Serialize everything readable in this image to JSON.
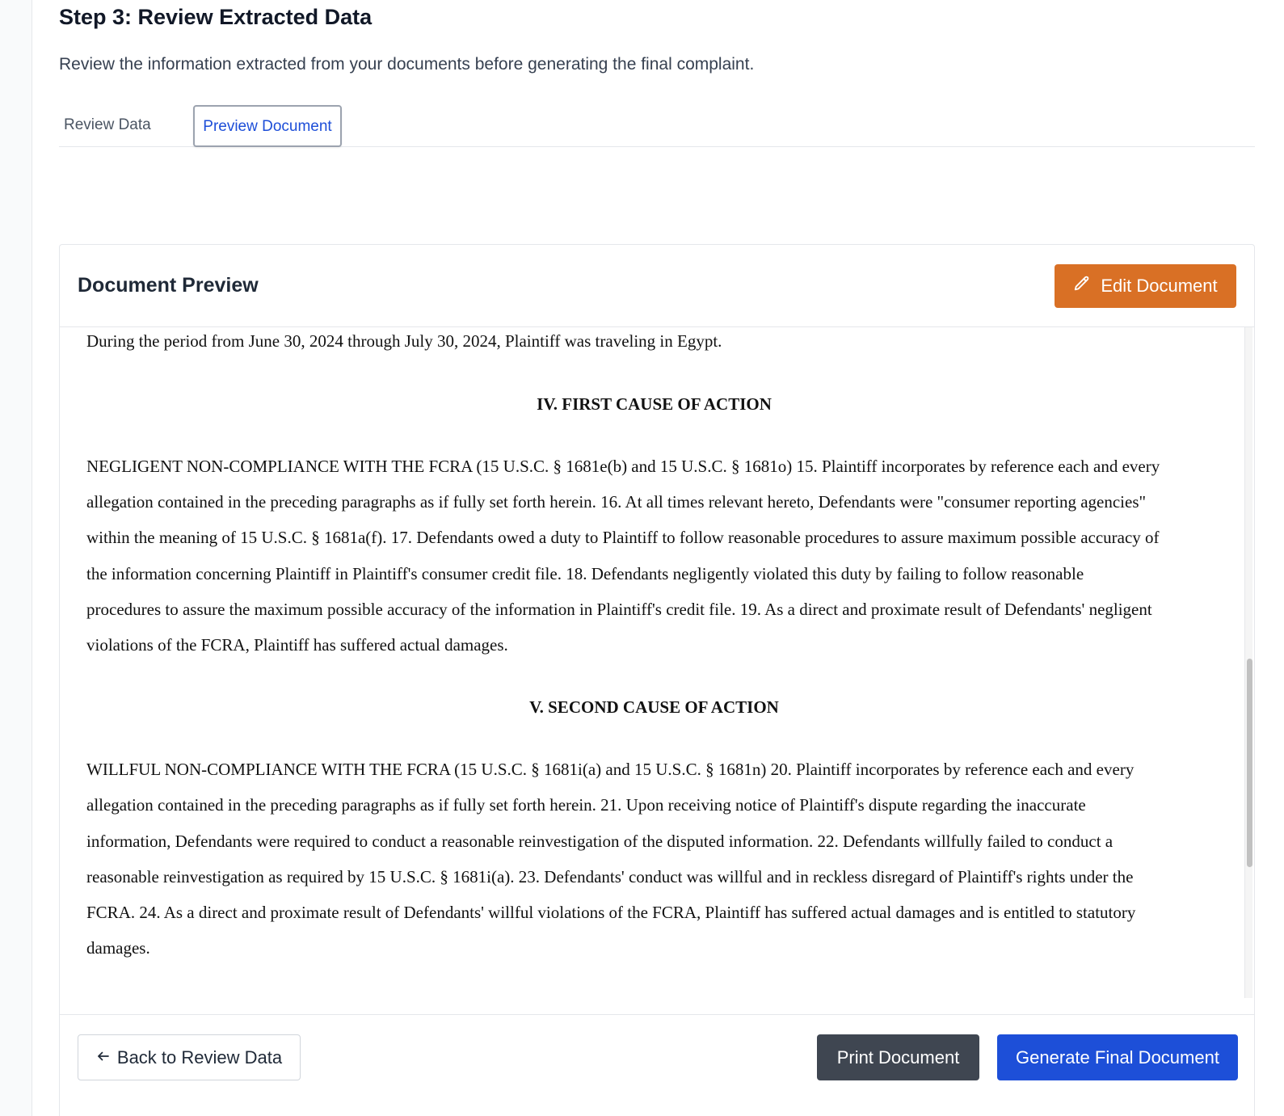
{
  "step": {
    "title": "Step 3: Review Extracted Data",
    "description": "Review the information extracted from your documents before generating the final complaint."
  },
  "tabs": [
    {
      "label": "Review Data",
      "active": false
    },
    {
      "label": "Preview Document",
      "active": true
    }
  ],
  "preview": {
    "title": "Document Preview",
    "edit_label": "Edit Document",
    "edit_icon": "pencil-icon",
    "edit_color": "#d97025"
  },
  "document": {
    "intro": "During the period from June 30, 2024 through July 30, 2024, Plaintiff was traveling in Egypt.",
    "heading1": "IV. FIRST CAUSE OF ACTION",
    "para1_lines": [
      "NEGLIGENT NON-COMPLIANCE WITH THE FCRA (15 U.S.C. § 1681e(b) and 15 U.S.C. § 1681o) 15. Plaintiff incorporates by reference each and every",
      "allegation contained in the preceding paragraphs as if fully set forth herein. 16. At all times relevant hereto, Defendants were \"consumer reporting agencies\"",
      "within the meaning of 15 U.S.C. § 1681a(f). 17. Defendants owed a duty to Plaintiff to follow reasonable procedures to assure maximum possible accuracy of",
      "the information concerning Plaintiff in Plaintiff's consumer credit file. 18. Defendants negligently violated this duty by failing to follow reasonable",
      "procedures to assure the maximum possible accuracy of the information in Plaintiff's credit file. 19. As a direct and proximate result of Defendants' negligent",
      "violations of the FCRA, Plaintiff has suffered actual damages."
    ],
    "heading2": "V. SECOND CAUSE OF ACTION",
    "para2_lines": [
      "WILLFUL NON-COMPLIANCE WITH THE FCRA (15 U.S.C. § 1681i(a) and 15 U.S.C. § 1681n) 20. Plaintiff incorporates by reference each and every",
      "allegation contained in the preceding paragraphs as if fully set forth herein. 21. Upon receiving notice of Plaintiff's dispute regarding the inaccurate",
      "information, Defendants were required to conduct a reasonable reinvestigation of the disputed information. 22. Defendants willfully failed to conduct a",
      "reasonable reinvestigation as required by 15 U.S.C. § 1681i(a). 23. Defendants' conduct was willful and in reckless disregard of Plaintiff's rights under the",
      "FCRA. 24. As a direct and proximate result of Defendants' willful violations of the FCRA, Plaintiff has suffered actual damages and is entitled to statutory",
      "damages."
    ]
  },
  "footer": {
    "back_label": "Back to Review Data",
    "back_icon": "arrow-left-icon",
    "print_label": "Print Document",
    "generate_label": "Generate Final Document",
    "print_color": "#3f4651",
    "generate_color": "#1d4fd8"
  }
}
